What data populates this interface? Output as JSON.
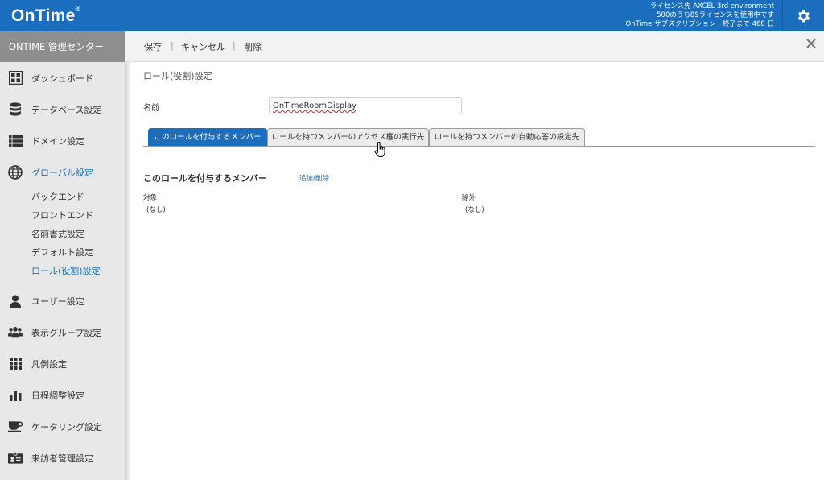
{
  "header": {
    "logo": "OnTime",
    "logo_mark": "®",
    "license_lines": [
      "ライセンス先 AXCEL 3rd environment",
      "500のうち89ライセンスを使用中です",
      "OnTime サブスクリプション | 終了まで 468 日"
    ]
  },
  "sidebar": {
    "title": "ONTIME 管理センター",
    "items": [
      {
        "label": "ダッシュボード",
        "icon": "dashboard-icon"
      },
      {
        "label": "データベース設定",
        "icon": "database-icon"
      },
      {
        "label": "ドメイン設定",
        "icon": "list-icon"
      },
      {
        "label": "グローバル設定",
        "icon": "globe-icon"
      },
      {
        "label": "ユーザー設定",
        "icon": "user-icon"
      },
      {
        "label": "表示グループ設定",
        "icon": "group-icon"
      },
      {
        "label": "凡例設定",
        "icon": "grid-icon"
      },
      {
        "label": "日程調整設定",
        "icon": "bar-chart-icon"
      },
      {
        "label": "ケータリング設定",
        "icon": "coffee-icon"
      },
      {
        "label": "来訪者管理設定",
        "icon": "id-card-icon"
      }
    ],
    "sub_items": [
      "バックエンド",
      "フロントエンド",
      "名前書式設定",
      "デフォルト設定",
      "ロール(役割)設定"
    ]
  },
  "toolbar": {
    "save": "保存",
    "cancel": "キャンセル",
    "delete": "削除",
    "separator": "|"
  },
  "page": {
    "title": "ロール(役割)設定",
    "name_label": "名前",
    "name_value": "OnTimeRoomDisplay"
  },
  "tabs": [
    "このロールを付与するメンバー",
    "ロールを持つメンバーのアクセス権の実行先",
    "ロールを持つメンバーの自動応答の設定先"
  ],
  "members": {
    "title": "このロールを付与するメンバー",
    "add_remove": "追加/削除",
    "target_head": "対象",
    "target_value": "(なし)",
    "exclude_head": "除外",
    "exclude_value": "(なし)"
  },
  "colors": {
    "brand_blue": "#1a6ebd",
    "sidebar_bg": "#e8e8e8",
    "sidebar_title_bg": "#8e8e8e"
  }
}
